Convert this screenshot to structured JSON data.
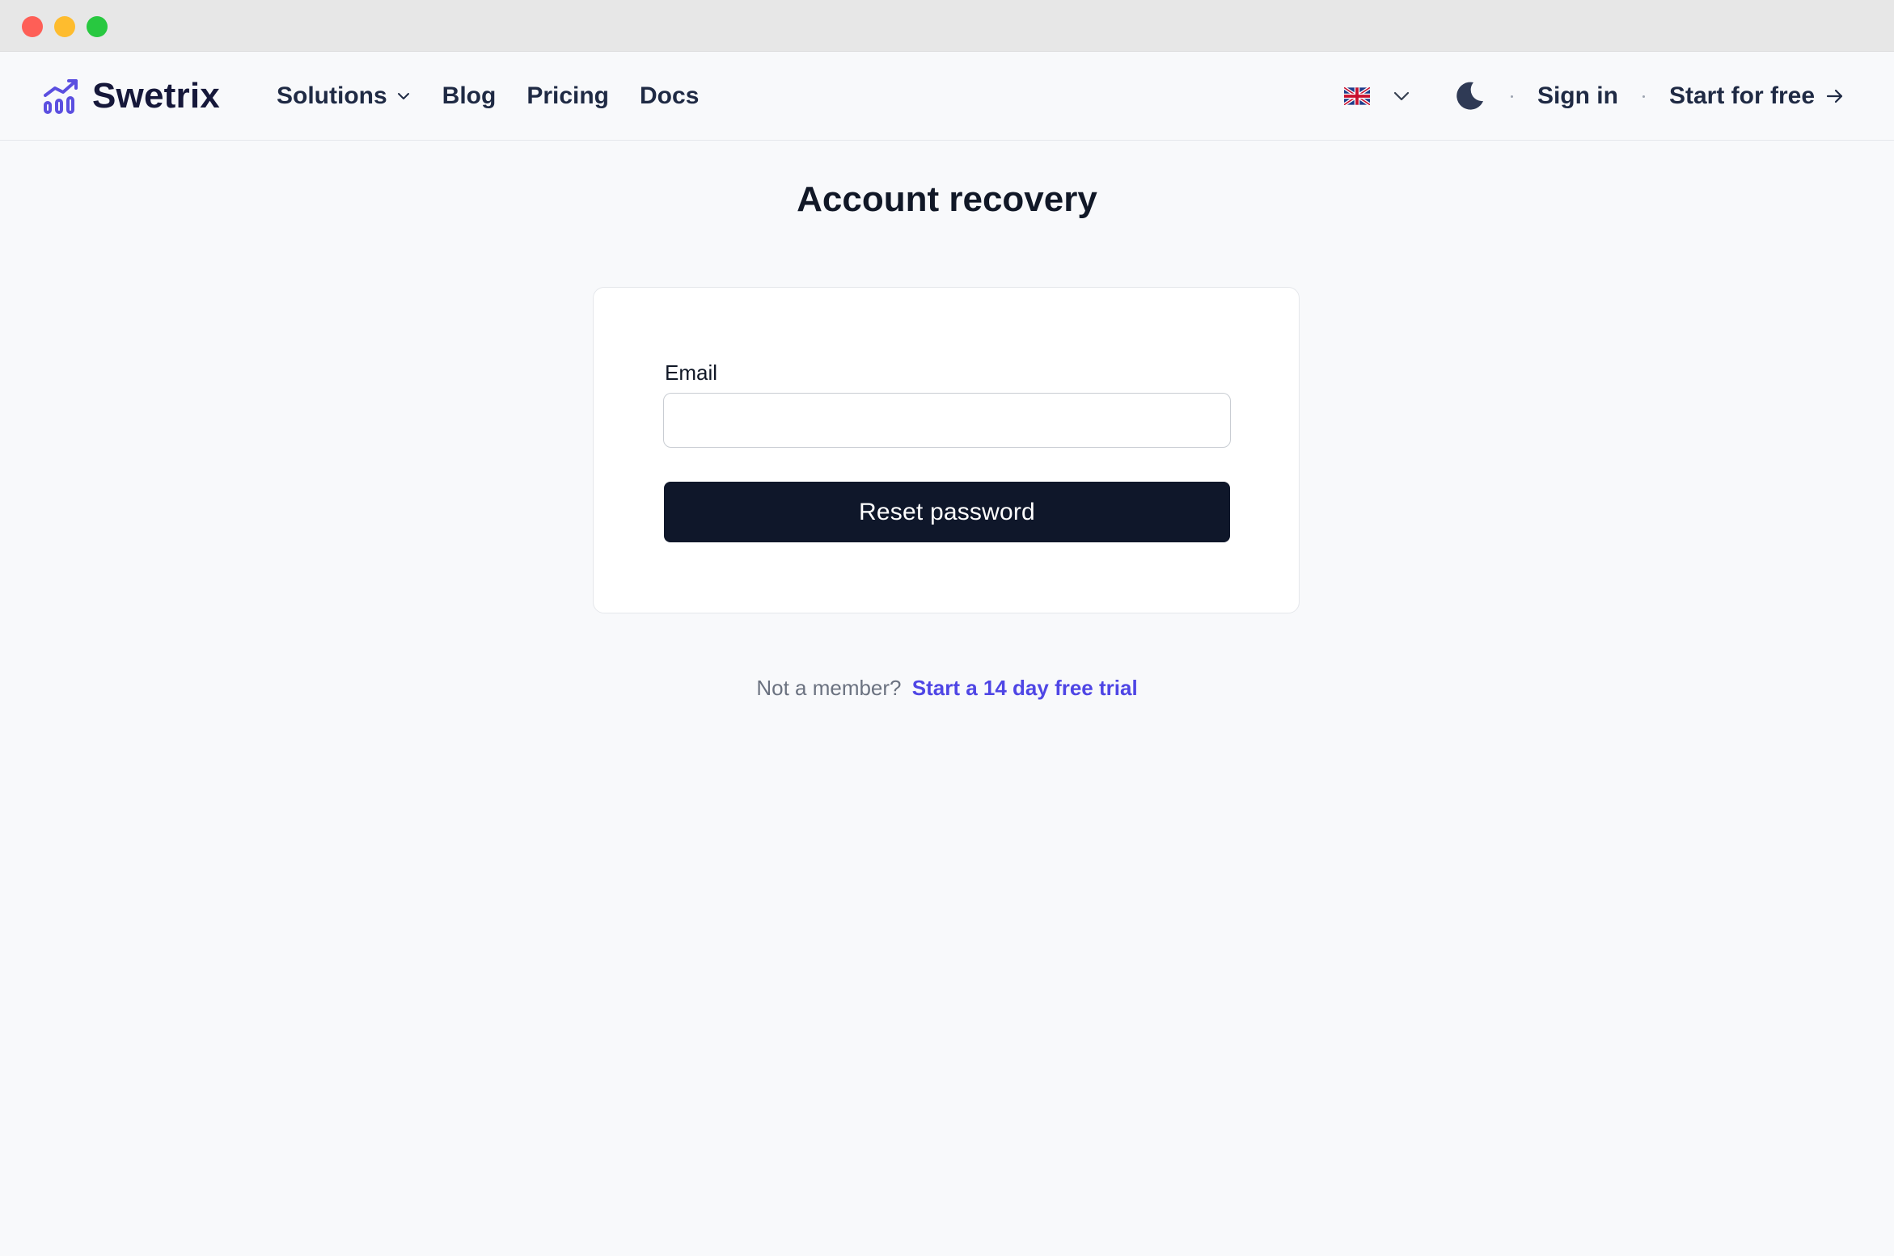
{
  "brand": {
    "name": "Swetrix",
    "accent_color": "#5b4fe0",
    "logo_icon": "chart-trend-icon"
  },
  "nav": {
    "items": [
      {
        "label": "Solutions",
        "has_dropdown": true
      },
      {
        "label": "Blog"
      },
      {
        "label": "Pricing"
      },
      {
        "label": "Docs"
      }
    ]
  },
  "header_right": {
    "language_icon": "uk-flag-icon",
    "theme_icon": "moon-icon",
    "sign_in": "Sign in",
    "start_free": "Start for free"
  },
  "page": {
    "title": "Account recovery"
  },
  "form": {
    "email_label": "Email",
    "email_value": "",
    "email_placeholder": "",
    "submit_label": "Reset password",
    "submit_color": "#0f172a"
  },
  "footer": {
    "prompt": "Not a member?",
    "link": "Start a 14 day free trial",
    "link_color": "#4f46e5"
  }
}
